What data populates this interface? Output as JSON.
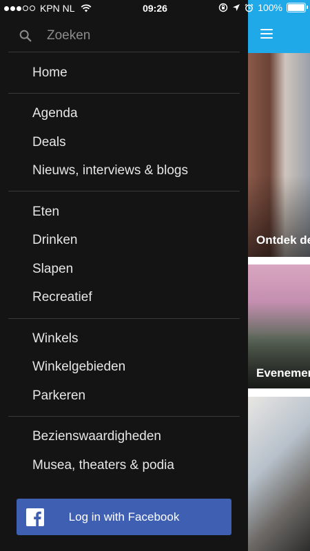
{
  "status_bar": {
    "carrier": "KPN NL",
    "time": "09:26",
    "battery": "100%",
    "signal_bars_filled": 3,
    "signal_bars_total": 5
  },
  "search": {
    "placeholder": "Zoeken",
    "icon": "search-icon"
  },
  "menu": {
    "home": "Home",
    "agenda": "Agenda",
    "deals": "Deals",
    "news": "Nieuws, interviews & blogs",
    "eten": "Eten",
    "drinken": "Drinken",
    "slapen": "Slapen",
    "recreatief": "Recreatief",
    "winkels": "Winkels",
    "winkelgebieden": "Winkelgebieden",
    "parkeren": "Parkeren",
    "bezienswaardigheden": "Bezienswaardigheden",
    "musea": "Musea, theaters & podia"
  },
  "facebook": {
    "label": "Log in with Facebook",
    "icon": "facebook-icon"
  },
  "background": {
    "card1_label": "Ontdek de",
    "card2_label": "Evenemen",
    "header_color": "#1fa9e8"
  },
  "colors": {
    "drawer_bg": "#141414",
    "facebook_blue": "#3f5fb3",
    "text": "#e6e6e6",
    "placeholder": "#8c8c8c"
  }
}
